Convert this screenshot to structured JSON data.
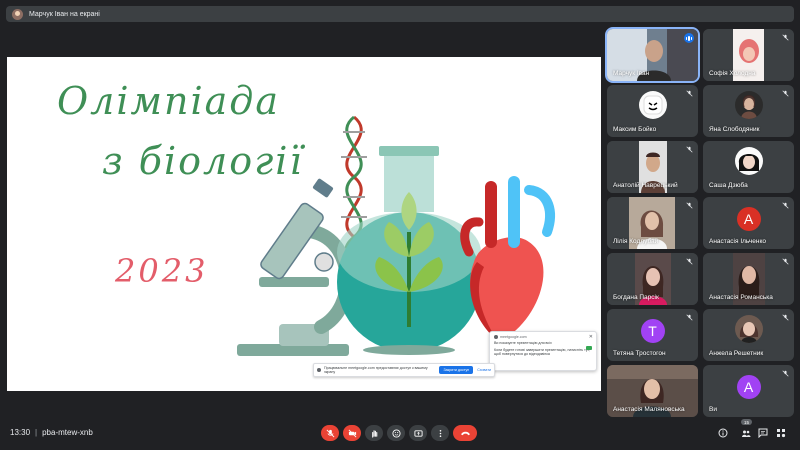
{
  "presenter_banner": {
    "text": "Марчук Іван на екрані"
  },
  "slide": {
    "title_line1": "Олімпіада",
    "title_line2": "з біології",
    "year": "2023"
  },
  "notice": {
    "source": "meetgoogle.com",
    "title": "Ви показуєте презентацію для всіх",
    "body": "Коли будете готові завершити презентацію, натисніть тут, щоб повернутися до відеодзвінка"
  },
  "share_bar": {
    "text": "Працювальне meetgoogle.com предоставляє доступ к вашему экрану",
    "stop_label": "Закрити доступ",
    "hide_label": "Сховати"
  },
  "participants": [
    {
      "name": "Марчук Іван",
      "type": "camera",
      "speaking": true
    },
    {
      "name": "Софія Холодна",
      "type": "photo",
      "color": "#e57373"
    },
    {
      "name": "Максим Бойко",
      "type": "avatar",
      "color": "#ffffff"
    },
    {
      "name": "Яна Слободяник",
      "type": "photo",
      "color": "#6d4c41"
    },
    {
      "name": "Анатолій Наврецький",
      "type": "photo",
      "color": "#5d4037"
    },
    {
      "name": "Саша Дзюба",
      "type": "photo",
      "color": "#fafafa"
    },
    {
      "name": "Лілія Кодлубай",
      "type": "camera",
      "color": "#a1887f"
    },
    {
      "name": "Анастасія Ільченко",
      "type": "letter",
      "letter": "А",
      "color": "#d93025"
    },
    {
      "name": "Богдана Парсік",
      "type": "camera",
      "color": "#8d6e63"
    },
    {
      "name": "Анастасія Романська",
      "type": "camera",
      "color": "#795548"
    },
    {
      "name": "Тетяна Тростогон",
      "type": "letter",
      "letter": "Т",
      "color": "#a142f4"
    },
    {
      "name": "Анжела Решетник",
      "type": "photo",
      "color": "#8d6e63"
    },
    {
      "name": "Анастасія Маляновська",
      "type": "camera",
      "color": "#6d4c41"
    },
    {
      "name": "Ви",
      "type": "letter",
      "letter": "А",
      "color": "#a142f4"
    }
  ],
  "bottom": {
    "time": "13:30",
    "separator": "|",
    "meeting_code": "pba-mtew-xnb",
    "participant_count": "15"
  },
  "colors": {
    "background": "#202124",
    "tile": "#3c4043",
    "danger": "#ea4335",
    "accent": "#1a73e8",
    "slide_green": "#3f8f56",
    "slide_pink": "#e35d6a"
  }
}
